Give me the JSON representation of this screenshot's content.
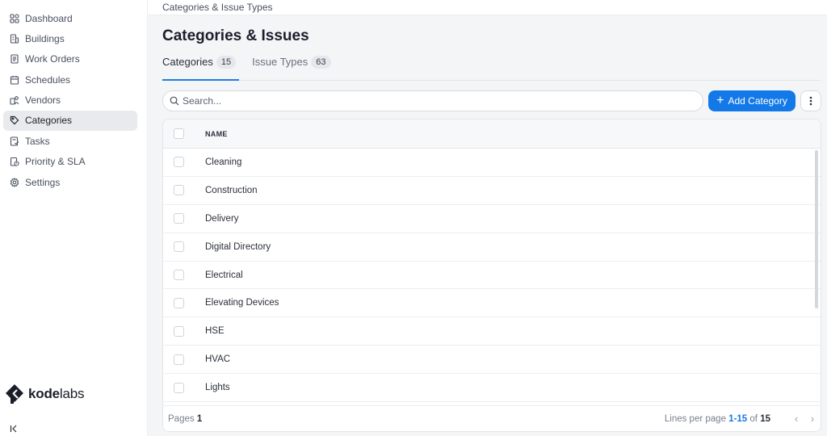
{
  "sidebar": {
    "items": [
      {
        "label": "Dashboard",
        "icon": "dashboard-icon"
      },
      {
        "label": "Buildings",
        "icon": "building-icon"
      },
      {
        "label": "Work Orders",
        "icon": "work-order-icon"
      },
      {
        "label": "Schedules",
        "icon": "calendar-icon"
      },
      {
        "label": "Vendors",
        "icon": "vendor-icon"
      },
      {
        "label": "Categories",
        "icon": "tag-icon",
        "active": true
      },
      {
        "label": "Tasks",
        "icon": "task-icon"
      },
      {
        "label": "Priority & SLA",
        "icon": "priority-icon"
      },
      {
        "label": "Settings",
        "icon": "gear-icon"
      }
    ],
    "logo_bold": "kode",
    "logo_light": "labs"
  },
  "header": {
    "breadcrumb": "Categories & Issue Types",
    "title": "Categories & Issues"
  },
  "tabs": [
    {
      "label": "Categories",
      "count": "15"
    },
    {
      "label": "Issue Types",
      "count": "63"
    }
  ],
  "search": {
    "placeholder": "Search..."
  },
  "toolbar": {
    "add_label": "Add Category"
  },
  "table": {
    "column": "NAME",
    "rows": [
      "Cleaning",
      "Construction",
      "Delivery",
      "Digital Directory",
      "Electrical",
      "Elevating Devices",
      "HSE",
      "HVAC",
      "Lights"
    ]
  },
  "footer": {
    "pages_label": "Pages",
    "pages_value": "1",
    "lines_label": "Lines per page",
    "range": "1-15",
    "of_label": "of",
    "total": "15"
  },
  "colors": {
    "accent": "#1479e8",
    "active_bg": "#e9eaed"
  }
}
